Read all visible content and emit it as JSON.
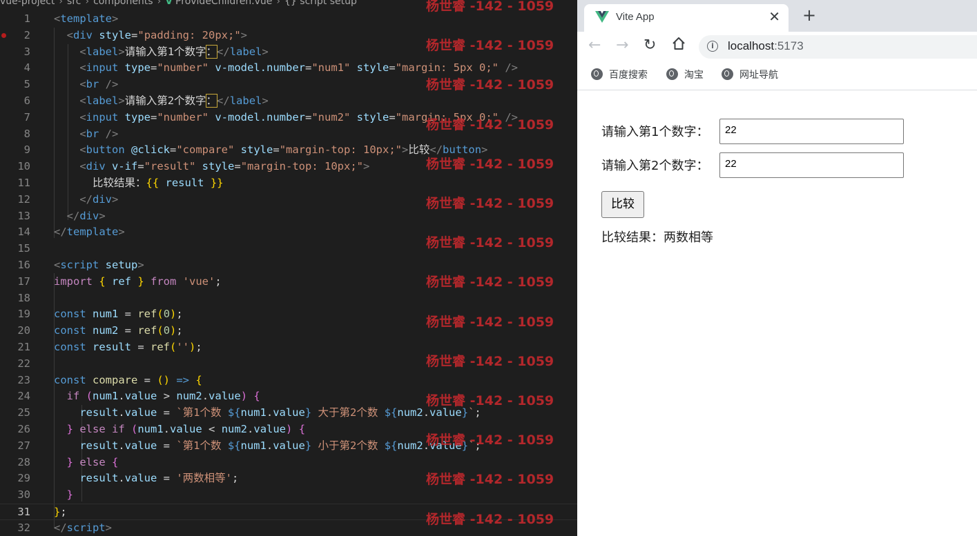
{
  "editor": {
    "breadcrumb": [
      "vue-project",
      "src",
      "components",
      "ProvideChildren.vue",
      "{} script setup"
    ],
    "line_numbers": [
      "1",
      "2",
      "3",
      "4",
      "5",
      "6",
      "7",
      "8",
      "9",
      "10",
      "11",
      "12",
      "13",
      "14",
      "15",
      "16",
      "17",
      "18",
      "19",
      "20",
      "21",
      "22",
      "23",
      "24",
      "25",
      "26",
      "27",
      "28",
      "29",
      "30",
      "31",
      "32"
    ],
    "lines": [
      [
        [
          "t-brk",
          "<"
        ],
        [
          "t-tag",
          "template"
        ],
        [
          "t-brk",
          ">"
        ]
      ],
      [
        [
          "t-txt",
          "  "
        ],
        [
          "t-brk",
          "<"
        ],
        [
          "t-tag",
          "div "
        ],
        [
          "t-attr",
          "style"
        ],
        [
          "t-txt",
          "="
        ],
        [
          "t-str",
          "\"padding: 20px;\""
        ],
        [
          "t-brk",
          ">"
        ]
      ],
      [
        [
          "t-txt",
          "    "
        ],
        [
          "t-brk",
          "<"
        ],
        [
          "t-tag",
          "label"
        ],
        [
          "t-brk",
          ">"
        ],
        [
          "t-txt",
          "请输入第1个数字"
        ],
        [
          "t-ph",
          "："
        ],
        [
          "t-brk",
          "</"
        ],
        [
          "t-tag",
          "label"
        ],
        [
          "t-brk",
          ">"
        ]
      ],
      [
        [
          "t-txt",
          "    "
        ],
        [
          "t-brk",
          "<"
        ],
        [
          "t-tag",
          "input "
        ],
        [
          "t-attr",
          "type"
        ],
        [
          "t-txt",
          "="
        ],
        [
          "t-str",
          "\"number\" "
        ],
        [
          "t-attr",
          "v-model.number"
        ],
        [
          "t-txt",
          "="
        ],
        [
          "t-str",
          "\"num1\" "
        ],
        [
          "t-attr",
          "style"
        ],
        [
          "t-txt",
          "="
        ],
        [
          "t-str",
          "\"margin: 5px 0;\" "
        ],
        [
          "t-brk",
          "/>"
        ]
      ],
      [
        [
          "t-txt",
          "    "
        ],
        [
          "t-brk",
          "<"
        ],
        [
          "t-tag",
          "br "
        ],
        [
          "t-brk",
          "/>"
        ]
      ],
      [
        [
          "t-txt",
          "    "
        ],
        [
          "t-brk",
          "<"
        ],
        [
          "t-tag",
          "label"
        ],
        [
          "t-brk",
          ">"
        ],
        [
          "t-txt",
          "请输入第2个数字"
        ],
        [
          "t-ph",
          "："
        ],
        [
          "t-brk",
          "</"
        ],
        [
          "t-tag",
          "label"
        ],
        [
          "t-brk",
          ">"
        ]
      ],
      [
        [
          "t-txt",
          "    "
        ],
        [
          "t-brk",
          "<"
        ],
        [
          "t-tag",
          "input "
        ],
        [
          "t-attr",
          "type"
        ],
        [
          "t-txt",
          "="
        ],
        [
          "t-str",
          "\"number\" "
        ],
        [
          "t-attr",
          "v-model.number"
        ],
        [
          "t-txt",
          "="
        ],
        [
          "t-str",
          "\"num2\" "
        ],
        [
          "t-attr",
          "style"
        ],
        [
          "t-txt",
          "="
        ],
        [
          "t-str",
          "\"margin: 5px 0;\" "
        ],
        [
          "t-brk",
          "/>"
        ]
      ],
      [
        [
          "t-txt",
          "    "
        ],
        [
          "t-brk",
          "<"
        ],
        [
          "t-tag",
          "br "
        ],
        [
          "t-brk",
          "/>"
        ]
      ],
      [
        [
          "t-txt",
          "    "
        ],
        [
          "t-brk",
          "<"
        ],
        [
          "t-tag",
          "button "
        ],
        [
          "t-attr",
          "@click"
        ],
        [
          "t-txt",
          "="
        ],
        [
          "t-str",
          "\"compare\" "
        ],
        [
          "t-attr",
          "style"
        ],
        [
          "t-txt",
          "="
        ],
        [
          "t-str",
          "\"margin-top: 10px;\""
        ],
        [
          "t-brk",
          ">"
        ],
        [
          "t-txt",
          "比较"
        ],
        [
          "t-brk",
          "</"
        ],
        [
          "t-tag",
          "button"
        ],
        [
          "t-brk",
          ">"
        ]
      ],
      [
        [
          "t-txt",
          "    "
        ],
        [
          "t-brk",
          "<"
        ],
        [
          "t-tag",
          "div "
        ],
        [
          "t-attr",
          "v-if"
        ],
        [
          "t-txt",
          "="
        ],
        [
          "t-str",
          "\"result\" "
        ],
        [
          "t-attr",
          "style"
        ],
        [
          "t-txt",
          "="
        ],
        [
          "t-str",
          "\"margin-top: 10px;\""
        ],
        [
          "t-brk",
          ">"
        ]
      ],
      [
        [
          "t-txt",
          "      比较结果："
        ],
        [
          "t-br1",
          "{{ "
        ],
        [
          "t-var",
          "result "
        ],
        [
          "t-br1",
          "}}"
        ]
      ],
      [
        [
          "t-txt",
          "    "
        ],
        [
          "t-brk",
          "</"
        ],
        [
          "t-tag",
          "div"
        ],
        [
          "t-brk",
          ">"
        ]
      ],
      [
        [
          "t-txt",
          "  "
        ],
        [
          "t-brk",
          "</"
        ],
        [
          "t-tag",
          "div"
        ],
        [
          "t-brk",
          ">"
        ]
      ],
      [
        [
          "t-brk",
          "</"
        ],
        [
          "t-tag",
          "template"
        ],
        [
          "t-brk",
          ">"
        ]
      ],
      [],
      [
        [
          "t-brk",
          "<"
        ],
        [
          "t-tag",
          "script "
        ],
        [
          "t-attr",
          "setup"
        ],
        [
          "t-brk",
          ">"
        ]
      ],
      [
        [
          "t-kw",
          "import "
        ],
        [
          "t-br1",
          "{ "
        ],
        [
          "t-var",
          "ref "
        ],
        [
          "t-br1",
          "} "
        ],
        [
          "t-kw",
          "from "
        ],
        [
          "t-str",
          "'vue'"
        ],
        [
          "t-txt",
          ";"
        ]
      ],
      [],
      [
        [
          "t-decl",
          "const "
        ],
        [
          "t-var",
          "num1 "
        ],
        [
          "t-txt",
          "= "
        ],
        [
          "t-fn",
          "ref"
        ],
        [
          "t-br1",
          "("
        ],
        [
          "t-num",
          "0"
        ],
        [
          "t-br1",
          ")"
        ],
        [
          "t-txt",
          ";"
        ]
      ],
      [
        [
          "t-decl",
          "const "
        ],
        [
          "t-var",
          "num2 "
        ],
        [
          "t-txt",
          "= "
        ],
        [
          "t-fn",
          "ref"
        ],
        [
          "t-br1",
          "("
        ],
        [
          "t-num",
          "0"
        ],
        [
          "t-br1",
          ")"
        ],
        [
          "t-txt",
          ";"
        ]
      ],
      [
        [
          "t-decl",
          "const "
        ],
        [
          "t-var",
          "result "
        ],
        [
          "t-txt",
          "= "
        ],
        [
          "t-fn",
          "ref"
        ],
        [
          "t-br1",
          "("
        ],
        [
          "t-str",
          "''"
        ],
        [
          "t-br1",
          ")"
        ],
        [
          "t-txt",
          ";"
        ]
      ],
      [],
      [
        [
          "t-decl",
          "const "
        ],
        [
          "t-fn",
          "compare "
        ],
        [
          "t-txt",
          "= "
        ],
        [
          "t-br1",
          "() "
        ],
        [
          "t-decl",
          "=> "
        ],
        [
          "t-br1",
          "{"
        ]
      ],
      [
        [
          "t-txt",
          "  "
        ],
        [
          "t-kw",
          "if "
        ],
        [
          "t-br2",
          "("
        ],
        [
          "t-var",
          "num1"
        ],
        [
          "t-txt",
          "."
        ],
        [
          "t-var",
          "value "
        ],
        [
          "t-txt",
          "> "
        ],
        [
          "t-var",
          "num2"
        ],
        [
          "t-txt",
          "."
        ],
        [
          "t-var",
          "value"
        ],
        [
          "t-br2",
          ") {"
        ]
      ],
      [
        [
          "t-txt",
          "    "
        ],
        [
          "t-var",
          "result"
        ],
        [
          "t-txt",
          "."
        ],
        [
          "t-var",
          "value "
        ],
        [
          "t-txt",
          "= "
        ],
        [
          "t-str",
          "`第1个数 "
        ],
        [
          "t-decl",
          "${"
        ],
        [
          "t-var",
          "num1"
        ],
        [
          "t-txt",
          "."
        ],
        [
          "t-var",
          "value"
        ],
        [
          "t-decl",
          "}"
        ],
        [
          "t-str",
          " 大于第2个数 "
        ],
        [
          "t-decl",
          "${"
        ],
        [
          "t-var",
          "num2"
        ],
        [
          "t-txt",
          "."
        ],
        [
          "t-var",
          "value"
        ],
        [
          "t-decl",
          "}"
        ],
        [
          "t-str",
          "`"
        ],
        [
          "t-txt",
          ";"
        ]
      ],
      [
        [
          "t-txt",
          "  "
        ],
        [
          "t-br2",
          "} "
        ],
        [
          "t-kw",
          "else if "
        ],
        [
          "t-br2",
          "("
        ],
        [
          "t-var",
          "num1"
        ],
        [
          "t-txt",
          "."
        ],
        [
          "t-var",
          "value "
        ],
        [
          "t-txt",
          "< "
        ],
        [
          "t-var",
          "num2"
        ],
        [
          "t-txt",
          "."
        ],
        [
          "t-var",
          "value"
        ],
        [
          "t-br2",
          ") {"
        ]
      ],
      [
        [
          "t-txt",
          "    "
        ],
        [
          "t-var",
          "result"
        ],
        [
          "t-txt",
          "."
        ],
        [
          "t-var",
          "value "
        ],
        [
          "t-txt",
          "= "
        ],
        [
          "t-str",
          "`第1个数 "
        ],
        [
          "t-decl",
          "${"
        ],
        [
          "t-var",
          "num1"
        ],
        [
          "t-txt",
          "."
        ],
        [
          "t-var",
          "value"
        ],
        [
          "t-decl",
          "}"
        ],
        [
          "t-str",
          " 小于第2个数 "
        ],
        [
          "t-decl",
          "${"
        ],
        [
          "t-var",
          "num2"
        ],
        [
          "t-txt",
          "."
        ],
        [
          "t-var",
          "value"
        ],
        [
          "t-decl",
          "}"
        ],
        [
          "t-str",
          "`"
        ],
        [
          "t-txt",
          ";"
        ]
      ],
      [
        [
          "t-txt",
          "  "
        ],
        [
          "t-br2",
          "} "
        ],
        [
          "t-kw",
          "else "
        ],
        [
          "t-br2",
          "{"
        ]
      ],
      [
        [
          "t-txt",
          "    "
        ],
        [
          "t-var",
          "result"
        ],
        [
          "t-txt",
          "."
        ],
        [
          "t-var",
          "value "
        ],
        [
          "t-txt",
          "= "
        ],
        [
          "t-str",
          "'两数相等'"
        ],
        [
          "t-txt",
          ";"
        ]
      ],
      [
        [
          "t-txt",
          "  "
        ],
        [
          "t-br2",
          "}"
        ]
      ],
      [
        [
          "t-br1",
          "}"
        ],
        [
          "t-txt",
          ";"
        ]
      ],
      [
        [
          "t-brk",
          "</"
        ],
        [
          "t-tag",
          "script"
        ],
        [
          "t-brk",
          ">"
        ]
      ]
    ],
    "current_line": 31
  },
  "watermark": {
    "text": "杨世睿 -142 - 1059",
    "count": 14
  },
  "browser": {
    "tab_title": "Vite App",
    "tab_close": "✕",
    "new_tab": "+",
    "url_host": "localhost",
    "url_port": ":5173",
    "bookmarks": [
      "百度搜索",
      "淘宝",
      "网址导航"
    ]
  },
  "app": {
    "label1": "请输入第1个数字：",
    "value1": "22",
    "label2": "请输入第2个数字：",
    "value2": "22",
    "compare_label": "比较",
    "result_text": "比较结果：两数相等"
  }
}
